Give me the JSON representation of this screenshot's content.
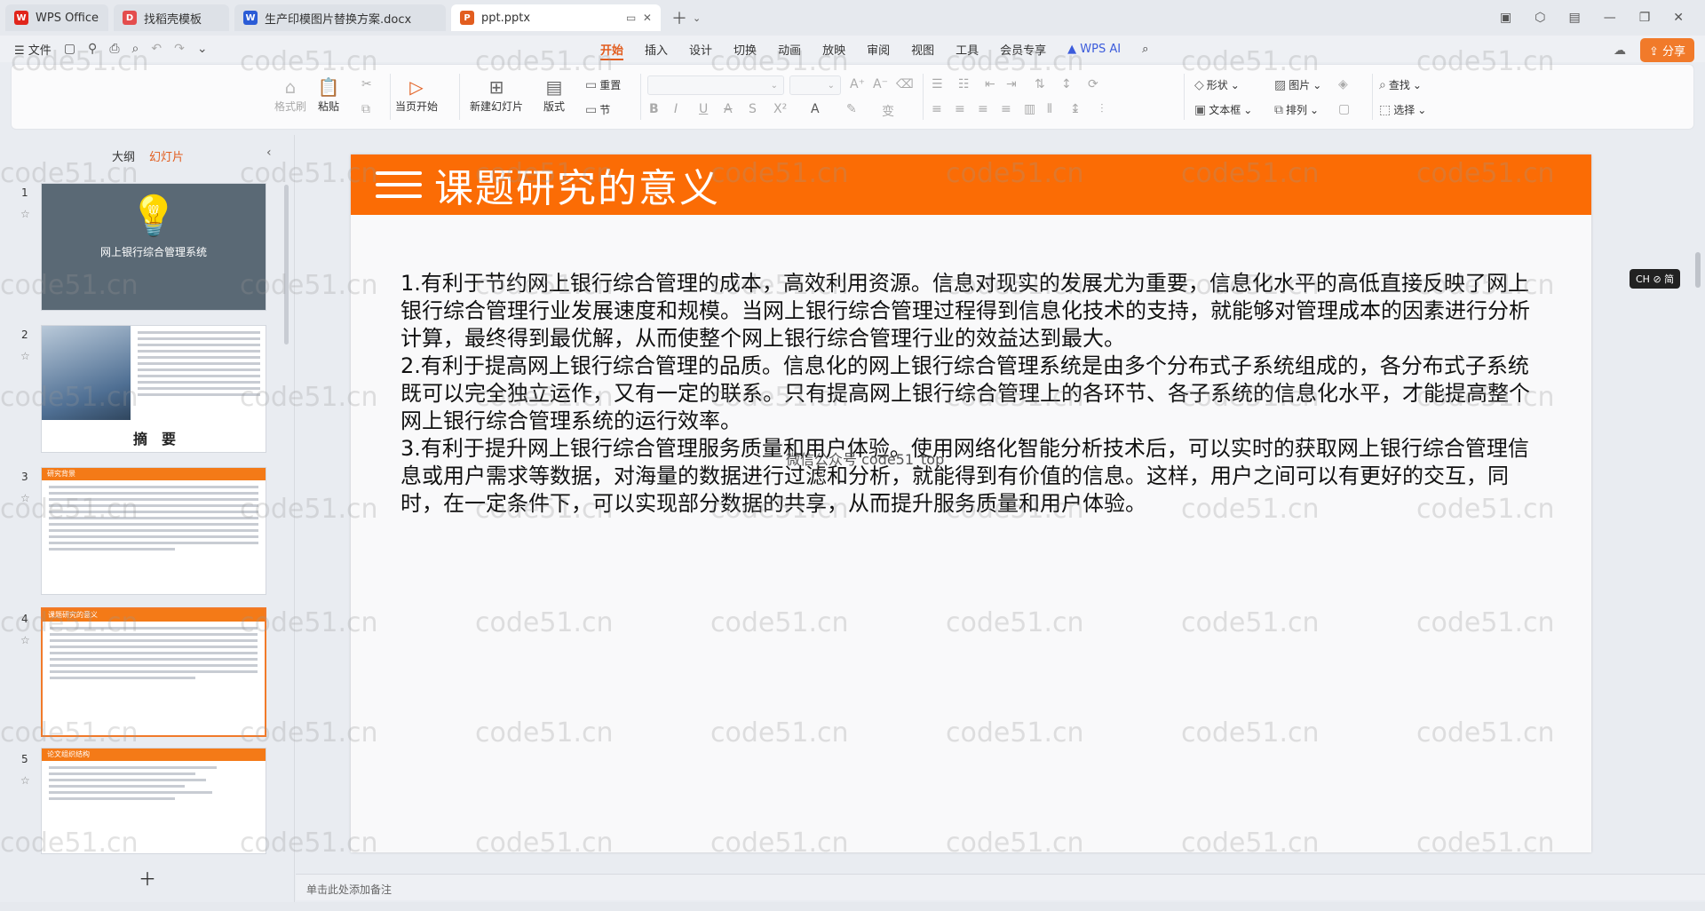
{
  "tabs": [
    {
      "label": "WPS Office",
      "icon": "wps-logo-icon",
      "color": "#e1251b"
    },
    {
      "label": "找稻壳模板",
      "icon": "docer-icon",
      "color": "#e44d4d"
    },
    {
      "label": "生产印模图片替换方案.docx",
      "icon": "word-icon",
      "color": "#2b5cd6"
    },
    {
      "label": "ppt.pptx",
      "icon": "ppt-icon",
      "color": "#e25d1f"
    }
  ],
  "menubar": {
    "file_label": "文件",
    "tabs": [
      "开始",
      "插入",
      "设计",
      "切换",
      "动画",
      "放映",
      "审阅",
      "视图",
      "工具",
      "会员专享"
    ],
    "ai_label": "WPS AI",
    "share_label": "分享"
  },
  "ribbon": {
    "format_painter": "格式刷",
    "paste": "粘贴",
    "play_current": "当页开始",
    "new_slide": "新建幻灯片",
    "layout": "版式",
    "reset": "重置",
    "section": "节",
    "shape": "形状",
    "picture": "图片",
    "textbox": "文本框",
    "arrange": "排列",
    "find": "查找",
    "select": "选择"
  },
  "left_panel": {
    "outline_tab": "大纲",
    "slides_tab": "幻灯片",
    "slide1_title": "网上银行综合管理系统",
    "slide2_title": "摘　要",
    "slide3_bar": "研究背景",
    "slide4_bar": "课题研究的意义",
    "slide5_bar": "论文组织结构",
    "numbers": [
      "1",
      "2",
      "3",
      "4",
      "5"
    ]
  },
  "slide": {
    "title": "课题研究的意义",
    "paragraphs": [
      "1.有利于节约网上银行综合管理的成本，高效利用资源。信息对现实的发展尤为重要，信息化水平的高低直接反映了网上银行综合管理行业发展速度和规模。当网上银行综合管理过程得到信息化技术的支持，就能够对管理成本的因素进行分析计算，最终得到最优解，从而使整个网上银行综合管理行业的效益达到最大。",
      "2.有利于提高网上银行综合管理的品质。信息化的网上银行综合管理系统是由多个分布式子系统组成的，各分布式子系统既可以完全独立运作，又有一定的联系。只有提高网上银行综合管理上的各环节、各子系统的信息化水平，才能提高整个网上银行综合管理系统的运行效率。",
      "3.有利于提升网上银行综合管理服务质量和用户体验。使用网络化智能分析技术后，可以实时的获取网上银行综合管理信息或用户需求等数据，对海量的数据进行过滤和分析，就能得到有价值的信息。这样，用户之间可以有更好的交互，同时，在一定条件下，可以实现部分数据的共享，从而提升服务质量和用户体验。"
    ],
    "center_watermark": "微信公众号 code51_top"
  },
  "lang_badge": "CH ⊘ 简",
  "notes_placeholder": "单击此处添加备注",
  "watermark": "code51.cn",
  "colors": {
    "accent": "#fb6c05",
    "brand_orange": "#f17a2a"
  }
}
